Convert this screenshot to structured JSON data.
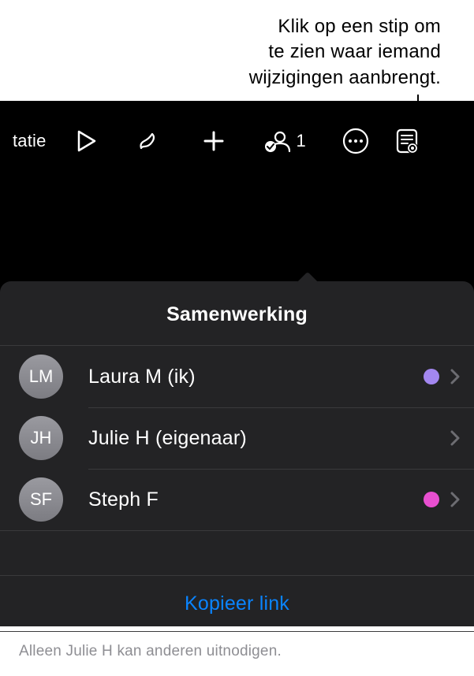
{
  "caption": {
    "line1": "Klik op een stip om",
    "line2": "te zien waar iemand",
    "line3": "wijzigingen aanbrengt."
  },
  "toolbar": {
    "left_text": "tatie",
    "collab_count": "1"
  },
  "popover": {
    "title": "Samenwerking",
    "participants": [
      {
        "initials": "LM",
        "name": "Laura M (ik)",
        "dot_color": "#a387f0",
        "show_dot": true
      },
      {
        "initials": "JH",
        "name": "Julie H (eigenaar)",
        "dot_color": "",
        "show_dot": false
      },
      {
        "initials": "SF",
        "name": "Steph F",
        "dot_color": "#e84fd0",
        "show_dot": true
      }
    ],
    "copy_link_label": "Kopieer link",
    "footer_note": "Alleen Julie H kan anderen uitnodigen."
  }
}
